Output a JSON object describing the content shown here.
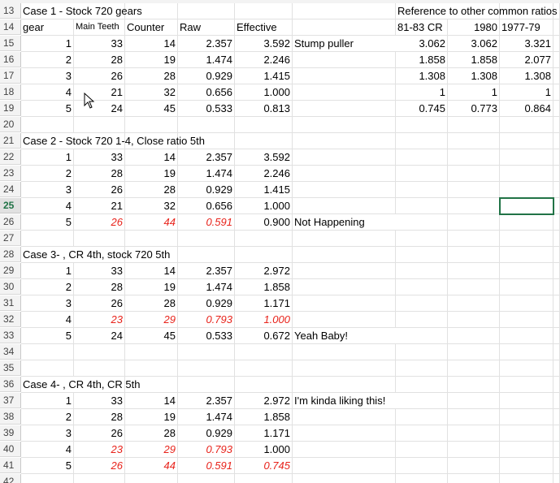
{
  "rows": [
    {
      "n": "13",
      "cells": {
        "B": "Case 1 - Stock 720 gears",
        "I": "Reference to other common ratios"
      }
    },
    {
      "n": "14",
      "cells": {
        "B": "gear",
        "C": "Main Teeth",
        "D": "Counter",
        "E": "Raw",
        "F": "Effective",
        "I": "81-83 CR",
        "J": "1980",
        "K": "1977-79"
      }
    },
    {
      "n": "15",
      "cells": {
        "B": "1",
        "C": "33",
        "D": "14",
        "E": "2.357",
        "F": "3.592",
        "G": "Stump puller",
        "I": "3.062",
        "J": "3.062",
        "K": "3.321"
      }
    },
    {
      "n": "16",
      "cells": {
        "B": "2",
        "C": "28",
        "D": "19",
        "E": "1.474",
        "F": "2.246",
        "I": "1.858",
        "J": "1.858",
        "K": "2.077"
      }
    },
    {
      "n": "17",
      "cells": {
        "B": "3",
        "C": "26",
        "D": "28",
        "E": "0.929",
        "F": "1.415",
        "I": "1.308",
        "J": "1.308",
        "K": "1.308"
      }
    },
    {
      "n": "18",
      "cells": {
        "B": "4",
        "C": "21",
        "D": "32",
        "E": "0.656",
        "F": "1.000",
        "I": "1",
        "J": "1",
        "K": "1"
      }
    },
    {
      "n": "19",
      "cells": {
        "B": "5",
        "C": "24",
        "D": "45",
        "E": "0.533",
        "F": "0.813",
        "I": "0.745",
        "J": "0.773",
        "K": "0.864"
      }
    },
    {
      "n": "20",
      "cells": {}
    },
    {
      "n": "21",
      "cells": {
        "B": "Case 2 - Stock 720 1-4, Close ratio 5th"
      }
    },
    {
      "n": "22",
      "cells": {
        "B": "1",
        "C": "33",
        "D": "14",
        "E": "2.357",
        "F": "3.592"
      }
    },
    {
      "n": "23",
      "cells": {
        "B": "2",
        "C": "28",
        "D": "19",
        "E": "1.474",
        "F": "2.246"
      }
    },
    {
      "n": "24",
      "cells": {
        "B": "3",
        "C": "26",
        "D": "28",
        "E": "0.929",
        "F": "1.415"
      }
    },
    {
      "n": "25",
      "cells": {
        "B": "4",
        "C": "21",
        "D": "32",
        "E": "0.656",
        "F": "1.000"
      }
    },
    {
      "n": "26",
      "cells": {
        "B": "5",
        "C": "26",
        "D": "44",
        "E": "0.591",
        "F": "0.900",
        "G": "Not Happening"
      },
      "red": [
        "C",
        "D",
        "E"
      ]
    },
    {
      "n": "27",
      "cells": {}
    },
    {
      "n": "28",
      "cells": {
        "B": "Case 3- , CR 4th, stock 720 5th"
      }
    },
    {
      "n": "29",
      "cells": {
        "B": "1",
        "C": "33",
        "D": "14",
        "E": "2.357",
        "F": "2.972"
      }
    },
    {
      "n": "30",
      "cells": {
        "B": "2",
        "C": "28",
        "D": "19",
        "E": "1.474",
        "F": "1.858"
      }
    },
    {
      "n": "31",
      "cells": {
        "B": "3",
        "C": "26",
        "D": "28",
        "E": "0.929",
        "F": "1.171"
      }
    },
    {
      "n": "32",
      "cells": {
        "B": "4",
        "C": "23",
        "D": "29",
        "E": "0.793",
        "F": "1.000"
      },
      "red": [
        "C",
        "D",
        "E",
        "F"
      ]
    },
    {
      "n": "33",
      "cells": {
        "B": "5",
        "C": "24",
        "D": "45",
        "E": "0.533",
        "F": "0.672",
        "G": "Yeah Baby!"
      }
    },
    {
      "n": "34",
      "cells": {}
    },
    {
      "n": "35",
      "cells": {}
    },
    {
      "n": "36",
      "cells": {
        "B": "Case 4- , CR 4th, CR 5th"
      }
    },
    {
      "n": "37",
      "cells": {
        "B": "1",
        "C": "33",
        "D": "14",
        "E": "2.357",
        "F": "2.972",
        "G": "I'm kinda liking this!"
      }
    },
    {
      "n": "38",
      "cells": {
        "B": "2",
        "C": "28",
        "D": "19",
        "E": "1.474",
        "F": "1.858"
      }
    },
    {
      "n": "39",
      "cells": {
        "B": "3",
        "C": "26",
        "D": "28",
        "E": "0.929",
        "F": "1.171"
      }
    },
    {
      "n": "40",
      "cells": {
        "B": "4",
        "C": "23",
        "D": "29",
        "E": "0.793",
        "F": "1.000"
      },
      "red": [
        "C",
        "D",
        "E"
      ]
    },
    {
      "n": "41",
      "cells": {
        "B": "5",
        "C": "26",
        "D": "44",
        "E": "0.591",
        "F": "0.745"
      },
      "red": [
        "C",
        "D",
        "E",
        "F"
      ]
    },
    {
      "n": "42",
      "cells": {}
    }
  ],
  "active_row": "25",
  "selected_cell": "K25",
  "colors": {
    "grid": "#e1e1e1",
    "header_bg": "#f3f3f3",
    "selection": "#217346",
    "red_text": "#e8231b"
  }
}
